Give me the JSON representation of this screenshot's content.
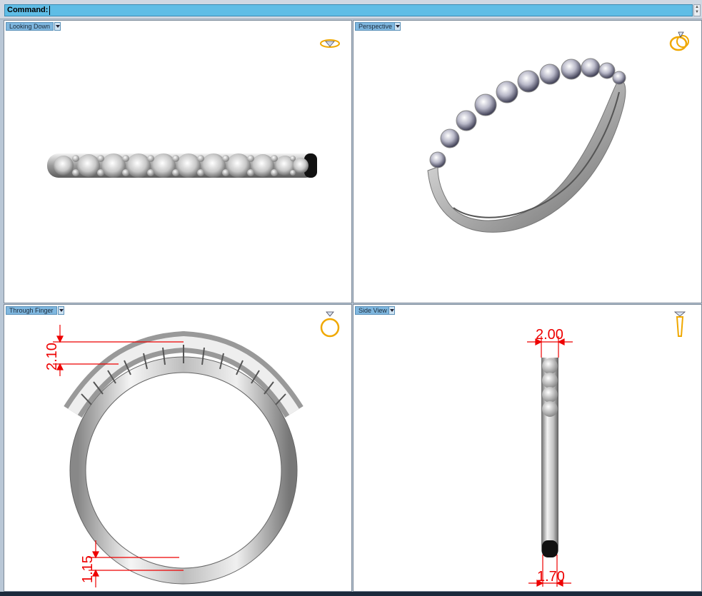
{
  "command": {
    "label": "Command:",
    "value": ""
  },
  "viewports": {
    "top_left": {
      "title": "Looking Down",
      "nav_icon": "ring-top-view-icon"
    },
    "top_right": {
      "title": "Perspective",
      "nav_icon": "ring-perspective-icon"
    },
    "bottom_left": {
      "title": "Through Finger",
      "nav_icon": "ring-front-view-icon"
    },
    "bottom_right": {
      "title": "Side View",
      "nav_icon": "ring-side-view-icon"
    }
  },
  "dimensions": {
    "through_finger_top": "2.10",
    "through_finger_bottom": "1.15",
    "side_top": "2.00",
    "side_bottom": "1.70"
  },
  "colors": {
    "command_bar": "#5fbde6",
    "dimension": "#e00000",
    "nav_icon": "#f0a800"
  }
}
